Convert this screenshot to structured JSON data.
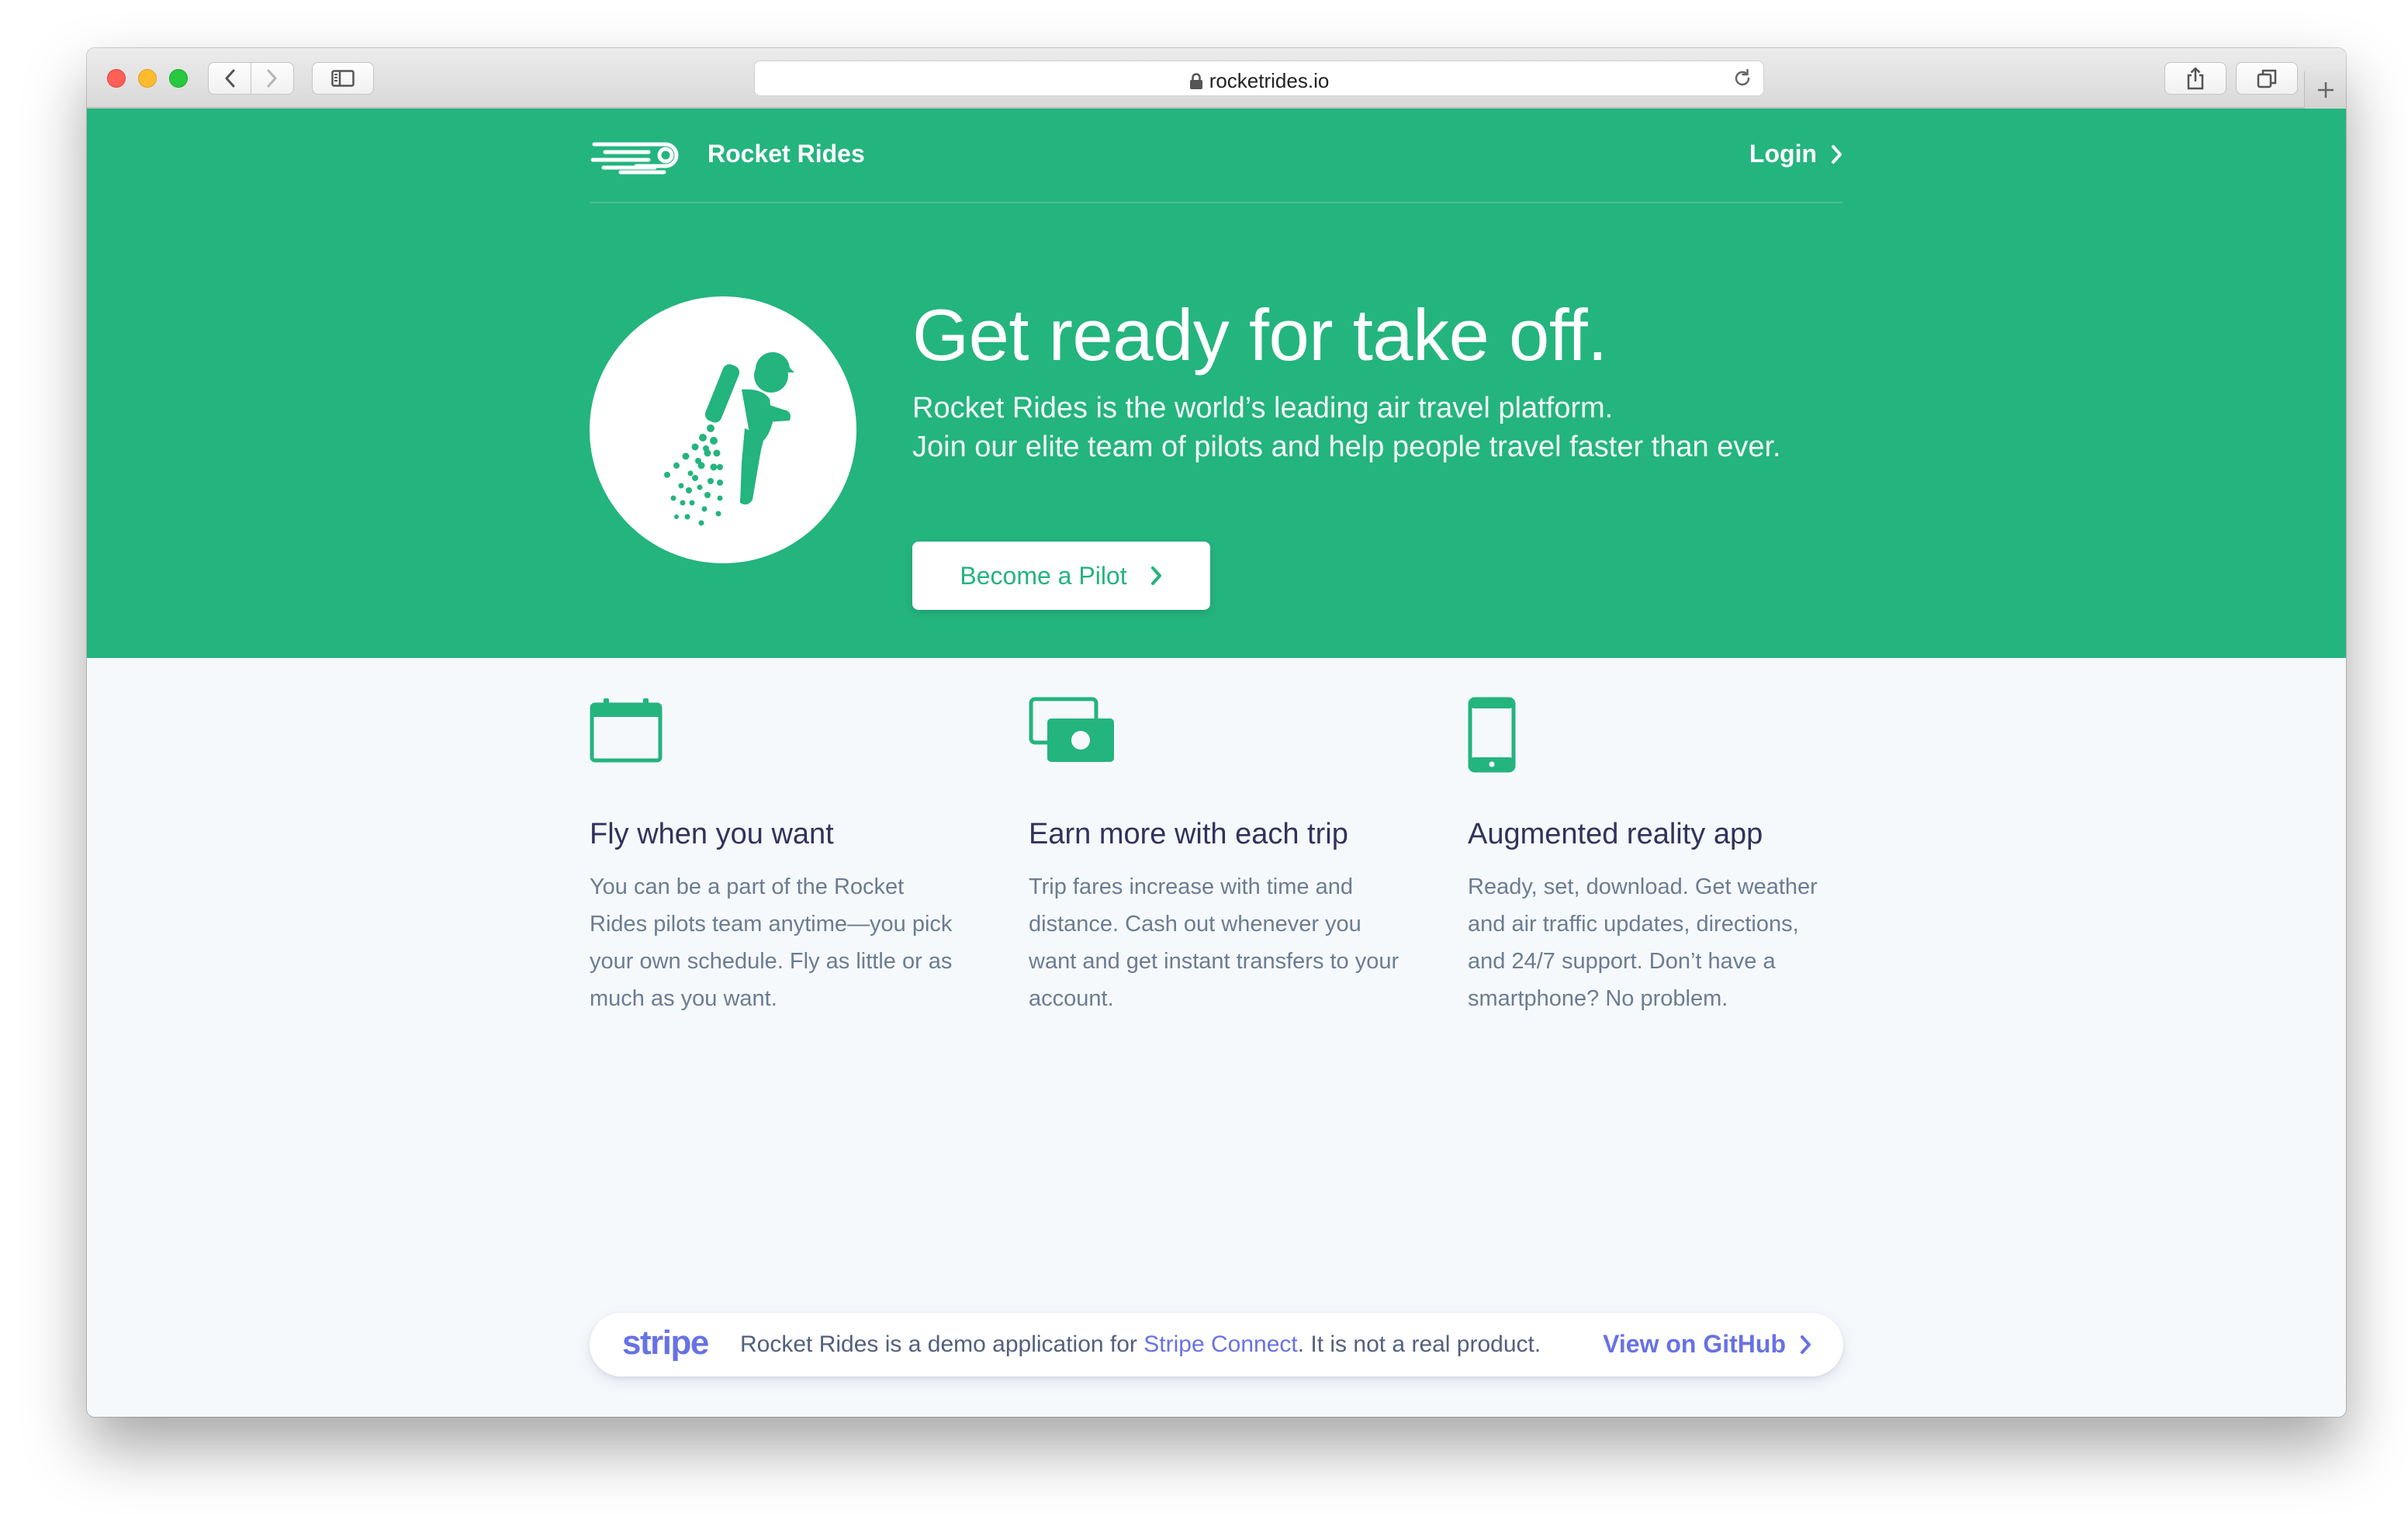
{
  "browser": {
    "url": "rocketrides.io"
  },
  "header": {
    "brand": "Rocket Rides",
    "login_label": "Login"
  },
  "hero": {
    "title": "Get ready for take off.",
    "subtitle_line1": "Rocket Rides is the world’s leading air travel platform.",
    "subtitle_line2": "Join our elite team of pilots and help people travel faster than ever.",
    "cta_label": "Become a Pilot"
  },
  "features": [
    {
      "icon": "calendar-icon",
      "title": "Fly when you want",
      "text": "You can be a part of the Rocket Rides pilots team anytime—you pick your own schedule. Fly as little or as much as you want."
    },
    {
      "icon": "money-icon",
      "title": "Earn more with each trip",
      "text": "Trip fares increase with time and distance. Cash out whenever you want and get instant transfers to your account."
    },
    {
      "icon": "smartphone-icon",
      "title": "Augmented reality app",
      "text": "Ready, set, download. Get weather and air traffic updates, directions, and 24/7 support. Don’t have a smartphone? No problem."
    }
  ],
  "banner": {
    "stripe_logo": "stripe",
    "text_before": "Rocket Rides is a demo application for ",
    "link_label": "Stripe Connect",
    "text_after": ". It is not a real product.",
    "github_label": "View on GitHub"
  },
  "colors": {
    "brand_green": "#24b47e",
    "stripe_purple": "#6772e5",
    "heading": "#32325d",
    "body_text": "#6b7c93"
  }
}
